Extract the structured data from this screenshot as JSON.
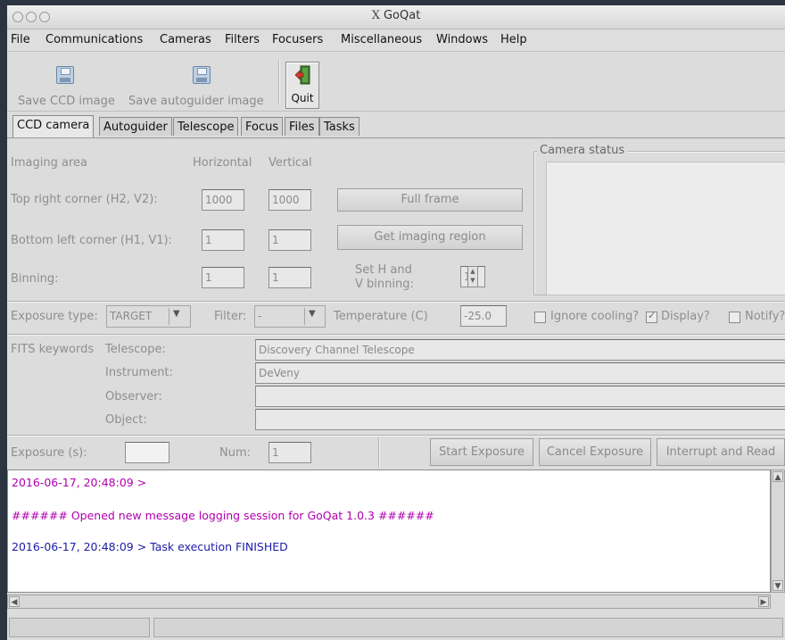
{
  "window": {
    "title": "GoQat",
    "title_glyph": "X"
  },
  "menu": [
    {
      "label": "File"
    },
    {
      "label": "Communications"
    },
    {
      "label": "Cameras"
    },
    {
      "label": "Filters"
    },
    {
      "label": "Focusers"
    },
    {
      "label": "Miscellaneous"
    },
    {
      "label": "Windows"
    },
    {
      "label": "Help"
    }
  ],
  "toolbar": {
    "save_ccd_label": "Save CCD image",
    "save_autoguider_label": "Save autoguider image",
    "quit_label": "Quit"
  },
  "tabs": [
    "CCD camera",
    "Autoguider",
    "Telescope",
    "Focus",
    "Files",
    "Tasks"
  ],
  "ccd": {
    "imaging_area_label": "Imaging area",
    "horizontal_label": "Horizontal",
    "vertical_label": "Vertical",
    "top_right_label": "Top right corner (H2, V2):",
    "top_right_h": "1000",
    "top_right_v": "1000",
    "full_frame_label": "Full frame",
    "bottom_left_label": "Bottom left corner (H1, V1):",
    "bottom_left_h": "1",
    "bottom_left_v": "1",
    "get_region_label": "Get imaging region",
    "binning_label": "Binning:",
    "binning_h": "1",
    "binning_v": "1",
    "set_binning_label_1": "Set H and",
    "set_binning_label_2": "V binning:",
    "set_binning_value": "1",
    "camera_status_label": "Camera status",
    "exposure_type_label": "Exposure type:",
    "exposure_type_value": "TARGET",
    "filter_label": "Filter:",
    "filter_value": "-",
    "temperature_label": "Temperature (C)",
    "temperature_value": "-25.0",
    "ignore_cooling_label": "Ignore cooling?",
    "display_label": "Display?",
    "notify_label": "Notify?",
    "ignore_cooling_checked": false,
    "display_checked": true,
    "notify_checked": false,
    "fits_keywords_label": "FITS keywords",
    "telescope_label": "Telescope:",
    "telescope_value": "Discovery Channel Telescope",
    "instrument_label": "Instrument:",
    "instrument_value": "DeVeny",
    "observer_label": "Observer:",
    "observer_value": "",
    "object_label": "Object:",
    "object_value": "",
    "exposure_s_label": "Exposure (s):",
    "exposure_s_value": "",
    "num_label": "Num:",
    "num_value": "1",
    "start_exposure_label": "Start Exposure",
    "cancel_exposure_label": "Cancel Exposure",
    "interrupt_label": "Interrupt and Read"
  },
  "log": [
    {
      "text": "2016-06-17, 20:48:09 >",
      "color": "#b000b0"
    },
    {
      "text": "###### Opened new message logging session for GoQat 1.0.3 ######",
      "color": "#b000b0"
    },
    {
      "text": "2016-06-17, 20:48:09 > Task execution FINISHED",
      "color": "#1c1ca8"
    }
  ],
  "colors": {
    "log_magenta": "#b000b0",
    "log_blue": "#1c1ca8"
  }
}
